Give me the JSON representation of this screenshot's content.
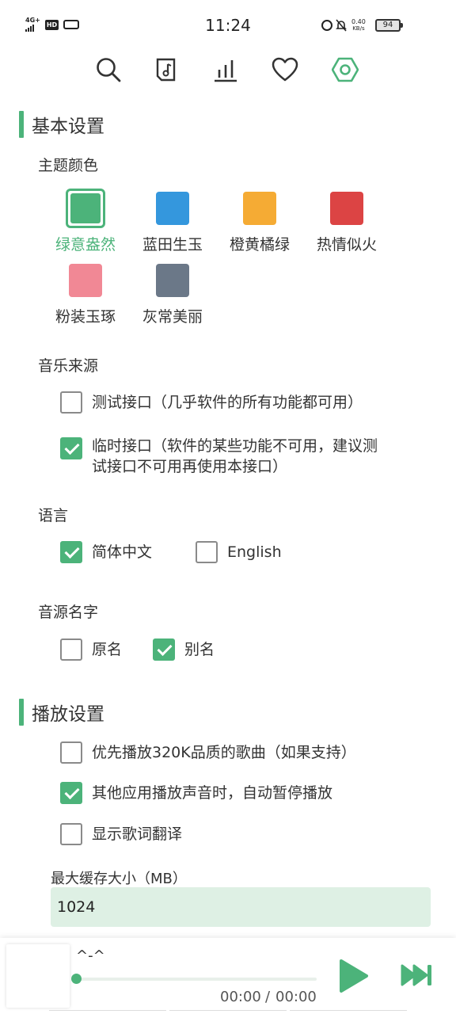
{
  "status_bar": {
    "network": "4G+",
    "hd": "HD",
    "time": "11:24",
    "speed_value": "0.40",
    "speed_unit": "KB/s",
    "battery": "94"
  },
  "nav": {
    "icons": [
      "search-icon",
      "music-file-icon",
      "chart-bars-icon",
      "heart-icon",
      "settings-icon"
    ],
    "active": "settings-icon"
  },
  "colors": {
    "accent": "#4cb37a",
    "input_bg": "#def0e4"
  },
  "basic": {
    "title": "基本设置",
    "theme_label": "主题颜色",
    "themes": [
      {
        "label": "绿意盎然",
        "color": "#4cb37a",
        "selected": true
      },
      {
        "label": "蓝田生玉",
        "color": "#3497dd",
        "selected": false
      },
      {
        "label": "橙黄橘绿",
        "color": "#f5ab34",
        "selected": false
      },
      {
        "label": "热情似火",
        "color": "#dc4444",
        "selected": false
      },
      {
        "label": "粉装玉琢",
        "color": "#f18895",
        "selected": false
      },
      {
        "label": "灰常美丽",
        "color": "#6b7888",
        "selected": false
      }
    ],
    "source_label": "音乐来源",
    "sources": [
      {
        "text": "测试接口（几乎软件的所有功能都可用）",
        "checked": false
      },
      {
        "text_line1": "临时接口（软件的某些功能不可用，建议测",
        "text_line2": "试接口不可用再使用本接口）",
        "checked": true
      }
    ],
    "language_label": "语言",
    "languages": [
      {
        "text": "简体中文",
        "checked": true
      },
      {
        "text": "English",
        "checked": false
      }
    ],
    "source_name_label": "音源名字",
    "source_names": [
      {
        "text": "原名",
        "checked": false
      },
      {
        "text": "别名",
        "checked": true
      }
    ]
  },
  "playback": {
    "title": "播放设置",
    "options": [
      {
        "text": "优先播放320K品质的歌曲（如果支持）",
        "checked": false
      },
      {
        "text": "其他应用播放声音时，自动暂停播放",
        "checked": true
      },
      {
        "text": "显示歌词翻译",
        "checked": false
      }
    ],
    "cache_label": "最大缓存大小（MB）",
    "cache_value": "1024"
  },
  "player": {
    "title": "^-^",
    "progress": 0,
    "time_current": "00:00",
    "time_separator": "/",
    "time_total": "00:00"
  }
}
